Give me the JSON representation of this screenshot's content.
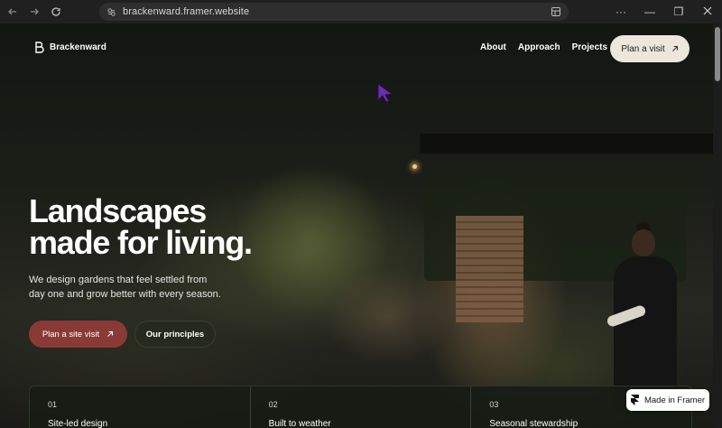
{
  "browser": {
    "url": "brackenward.framer.website",
    "back_icon": "arrow-left-icon",
    "forward_icon": "arrow-right-icon",
    "reload_icon": "reload-icon",
    "more_label": "···",
    "minimize_label": "—",
    "restore_label": "❐"
  },
  "site": {
    "brand": "Brackenward",
    "nav": [
      {
        "label": "About"
      },
      {
        "label": "Approach"
      },
      {
        "label": "Projects"
      }
    ],
    "nav_cta": "Plan a visit",
    "hero": {
      "title_line1": "Landscapes",
      "title_line2": "made for living.",
      "subtitle": "We design gardens that feel settled from day one and grow better with every season.",
      "primary_cta": "Plan a site visit",
      "secondary_cta": "Our principles"
    },
    "features": [
      {
        "num": "01",
        "title": "Site-led design"
      },
      {
        "num": "02",
        "title": "Built to weather"
      },
      {
        "num": "03",
        "title": "Seasonal stewardship"
      }
    ],
    "badge": "Made in Framer"
  },
  "colors": {
    "primary_button": "#8a3a36",
    "secondary_button": "#262a1d",
    "nav_cta_bg": "#ece6dc",
    "cursor": "#6a2fb0"
  }
}
